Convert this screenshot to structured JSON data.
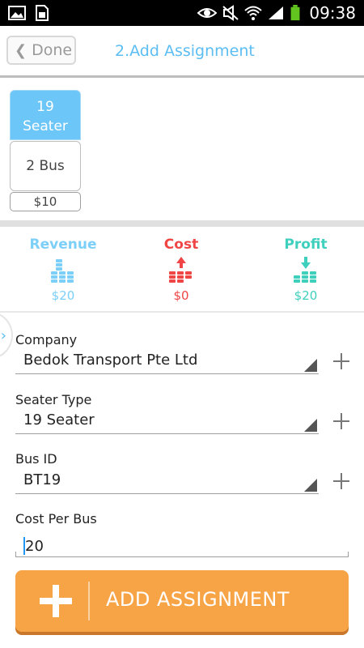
{
  "status_bar": {
    "time": "09:38",
    "icons": [
      "image-icon",
      "sim-card-icon",
      "eye-icon",
      "silent-icon",
      "wifi-icon",
      "signal-icon",
      "battery-icon"
    ]
  },
  "header": {
    "done_label": "Done",
    "title": "2.Add Assignment"
  },
  "seater_card": {
    "line1": "19",
    "line2": "Seater",
    "bus_count": "2 Bus",
    "price": "$10"
  },
  "summary": {
    "revenue": {
      "label": "Revenue",
      "value": "$20",
      "icon": "coins-stack-icon"
    },
    "cost": {
      "label": "Cost",
      "value": "$0",
      "icon": "coins-up-arrow-icon"
    },
    "profit": {
      "label": "Profit",
      "value": "$20",
      "icon": "coins-down-arrow-icon"
    }
  },
  "form": {
    "company": {
      "label": "Company",
      "value": "Bedok Transport Pte Ltd"
    },
    "seater_type": {
      "label": "Seater Type",
      "value": "19 Seater"
    },
    "bus_id": {
      "label": "Bus ID",
      "value": "BT19"
    },
    "cost_per_bus": {
      "label": "Cost Per Bus",
      "value": "20"
    }
  },
  "add_button": {
    "label": "ADD ASSIGNMENT"
  },
  "colors": {
    "accent_blue": "#5bbdf2",
    "revenue": "#7ccff8",
    "cost": "#ef4545",
    "profit": "#3fcfbd",
    "button_orange": "#f7a447"
  }
}
